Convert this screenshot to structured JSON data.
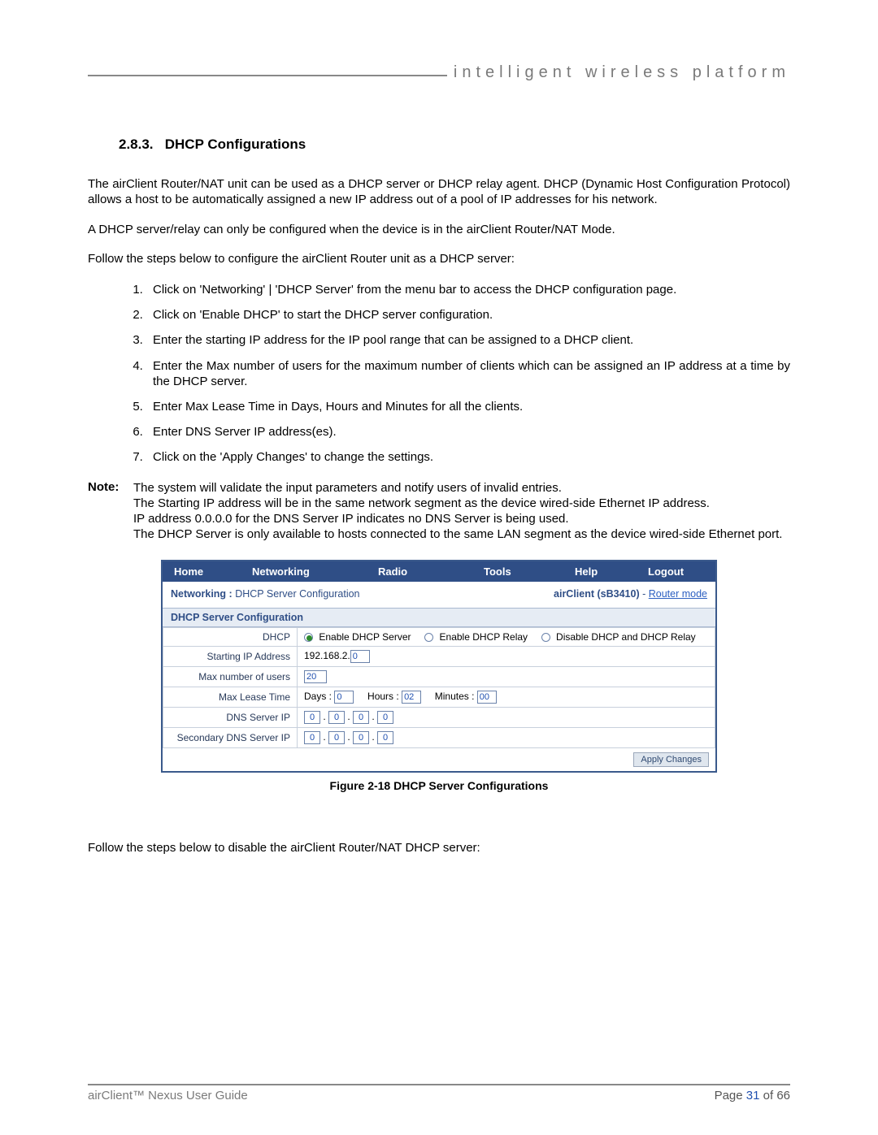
{
  "header": {
    "tagline": "intelligent wireless platform"
  },
  "section": {
    "number": "2.8.3.",
    "title": "DHCP Configurations",
    "p1": "The airClient Router/NAT unit can be used as a DHCP server or DHCP relay agent.  DHCP (Dynamic Host Configuration Protocol) allows a host to be automatically assigned a new IP address out of a pool of IP addresses for his network.",
    "p2": "A DHCP server/relay can only be configured when the device is in the airClient Router/NAT Mode.",
    "p3": "Follow the steps below to configure the airClient Router unit as a DHCP server:",
    "steps": [
      "Click on 'Networking' | 'DHCP Server' from the menu bar to access the DHCP configuration page.",
      "Click on 'Enable DHCP' to start the DHCP server configuration.",
      "Enter the starting IP address for the IP pool range that can be assigned to a DHCP client.",
      "Enter the Max number of users for the maximum number of clients which can be assigned an IP address at a time by the DHCP server.",
      "Enter Max Lease Time in Days, Hours and Minutes for all the clients.",
      "Enter DNS Server IP address(es).",
      "Click on the 'Apply Changes' to change the settings."
    ],
    "note_label": "Note:",
    "note_body": "The system will validate the input parameters and notify users of invalid entries.\nThe Starting IP address will be in the same network segment as the device wired-side Ethernet IP address.\nIP address 0.0.0.0 for the DNS Server IP indicates no DNS Server is being used.\nThe DHCP Server is only available to hosts connected to the same LAN segment as the device wired-side Ethernet port.",
    "p4": "Follow the steps below to disable the airClient Router/NAT DHCP server:"
  },
  "router": {
    "nav": {
      "home": "Home",
      "networking": "Networking",
      "radio": "Radio",
      "tools": "Tools",
      "help": "Help",
      "logout": "Logout"
    },
    "crumb_section": "Networking :",
    "crumb_page": "DHCP Server Configuration",
    "device": "airClient (sB3410)",
    "mode_sep": " - ",
    "mode_link": "Router mode",
    "panel_title": "DHCP Server Configuration",
    "rows": {
      "dhcp_label": "DHCP",
      "dhcp_opt1": "Enable DHCP Server",
      "dhcp_opt2": "Enable DHCP Relay",
      "dhcp_opt3": "Disable DHCP and DHCP Relay",
      "start_ip_label": "Starting IP Address",
      "start_ip_prefix": "192.168.2.",
      "start_ip_last": "0",
      "max_users_label": "Max number of users",
      "max_users": "20",
      "lease_label": "Max Lease Time",
      "lease_days_lbl": "Days :",
      "lease_days": "0",
      "lease_hours_lbl": "Hours :",
      "lease_hours": "02",
      "lease_min_lbl": "Minutes :",
      "lease_min": "00",
      "dns1_label": "DNS Server IP",
      "dns2_label": "Secondary DNS Server IP",
      "ip_oct": [
        "0",
        "0",
        "0",
        "0"
      ]
    },
    "apply": "Apply Changes"
  },
  "figure_caption": "Figure 2-18 DHCP Server Configurations",
  "footer": {
    "guide": "airClient™ Nexus User Guide",
    "page_prefix": "Page ",
    "page_current": "31",
    "page_of": " of 66"
  }
}
